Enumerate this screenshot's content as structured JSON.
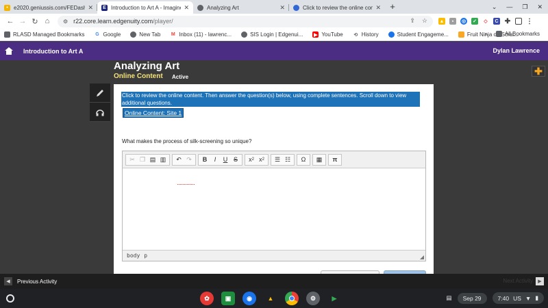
{
  "browser": {
    "tabs": [
      {
        "title": "e2020.geniussis.com/FEDashb",
        "favicon_color": "#f4b400"
      },
      {
        "title": "Introduction to Art A - Imagine E",
        "favicon_color": "#1a237e",
        "favicon_letter": "E",
        "active": true
      },
      {
        "title": "Analyzing Art",
        "favicon_color": "#5f6368"
      },
      {
        "title": "Click to review the online conten",
        "favicon_color": "#3367d6"
      }
    ],
    "new_tab": "+",
    "url_host": "r22.core.learn.edgenuity.com",
    "url_path": "/player/",
    "bookmarks": [
      {
        "label": "RLASD Managed Bookmarks",
        "icon": "folder-icon",
        "color": "#5f6368"
      },
      {
        "label": "Google",
        "icon": "google-icon",
        "color": "#4285f4"
      },
      {
        "label": "New Tab",
        "icon": "globe-icon",
        "color": "#5f6368"
      },
      {
        "label": "Inbox (11) - lawrenc...",
        "icon": "gmail-icon",
        "color": "#ea4335"
      },
      {
        "label": "SIS Login | Edgenui...",
        "icon": "globe-icon",
        "color": "#5f6368"
      },
      {
        "label": "YouTube",
        "icon": "youtube-icon",
        "color": "#ff0000"
      },
      {
        "label": "History",
        "icon": "history-icon",
        "color": "#5f6368"
      },
      {
        "label": "Student Engageme...",
        "icon": "edge-icon",
        "color": "#1a73e8"
      },
      {
        "label": "Fruit Ninja on Scrat...",
        "icon": "scratch-icon",
        "color": "#f9a825"
      }
    ],
    "bookmarks_overflow": "»",
    "all_bookmarks": "All Bookmarks"
  },
  "app": {
    "course": "Introduction to Art A",
    "user": "Dylan Lawrence",
    "lesson_title": "Analyzing Art",
    "subtitle": "Online Content",
    "status": "Active",
    "instructions": "Click to review the online content. Then answer the question(s) below, using complete sentences. Scroll down to view additional questions.",
    "link": "Online Content: Site 1",
    "question": "What makes the process of silk-screening so unique?",
    "editor_status_path": [
      "body",
      "p"
    ],
    "footer_prev": "Previous Activity",
    "footer_next": "Next Activity"
  },
  "shelf": {
    "date": "Sep 29",
    "time": "7:40",
    "locale": "US"
  }
}
